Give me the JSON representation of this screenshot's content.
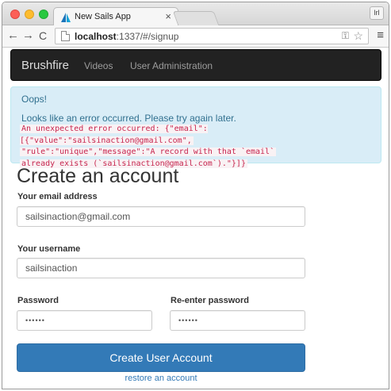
{
  "browser": {
    "tab_title": "New Sails App",
    "tab_close": "×",
    "profile_label": "lrl",
    "url_host": "localhost",
    "url_rest": ":1337/#/signup"
  },
  "navbar": {
    "brand": "Brushfire",
    "links": [
      "Videos",
      "User Administration"
    ]
  },
  "alert": {
    "title": "Oops!",
    "message": "Looks like an error occurred. Please try again later.",
    "code_lines": [
      "An unexpected error occurred: {\"email\":[{\"value\":\"sailsinaction@gmail.com\",",
      "\"rule\":\"unique\",\"message\":\"A record with that `email`",
      "already exists (`sailsinaction@gmail.com`).\"}]}"
    ]
  },
  "form": {
    "title": "Create an account",
    "email_label": "Your email address",
    "email_value": "sailsinaction@gmail.com",
    "username_label": "Your username",
    "username_value": "sailsinaction",
    "password_label": "Password",
    "password_value": "••••••",
    "repassword_label": "Re-enter password",
    "repassword_value": "••••••",
    "submit_label": "Create User Account",
    "restore_link": "restore an account"
  },
  "colors": {
    "navbar_bg": "#222222",
    "alert_bg": "#d9edf7",
    "primary": "#337ab7",
    "code_red": "#c7254e"
  },
  "icons": [
    "back-icon",
    "forward-icon",
    "reload-icon",
    "page-icon",
    "key-icon",
    "star-icon",
    "menu-icon",
    "sails-favicon"
  ]
}
